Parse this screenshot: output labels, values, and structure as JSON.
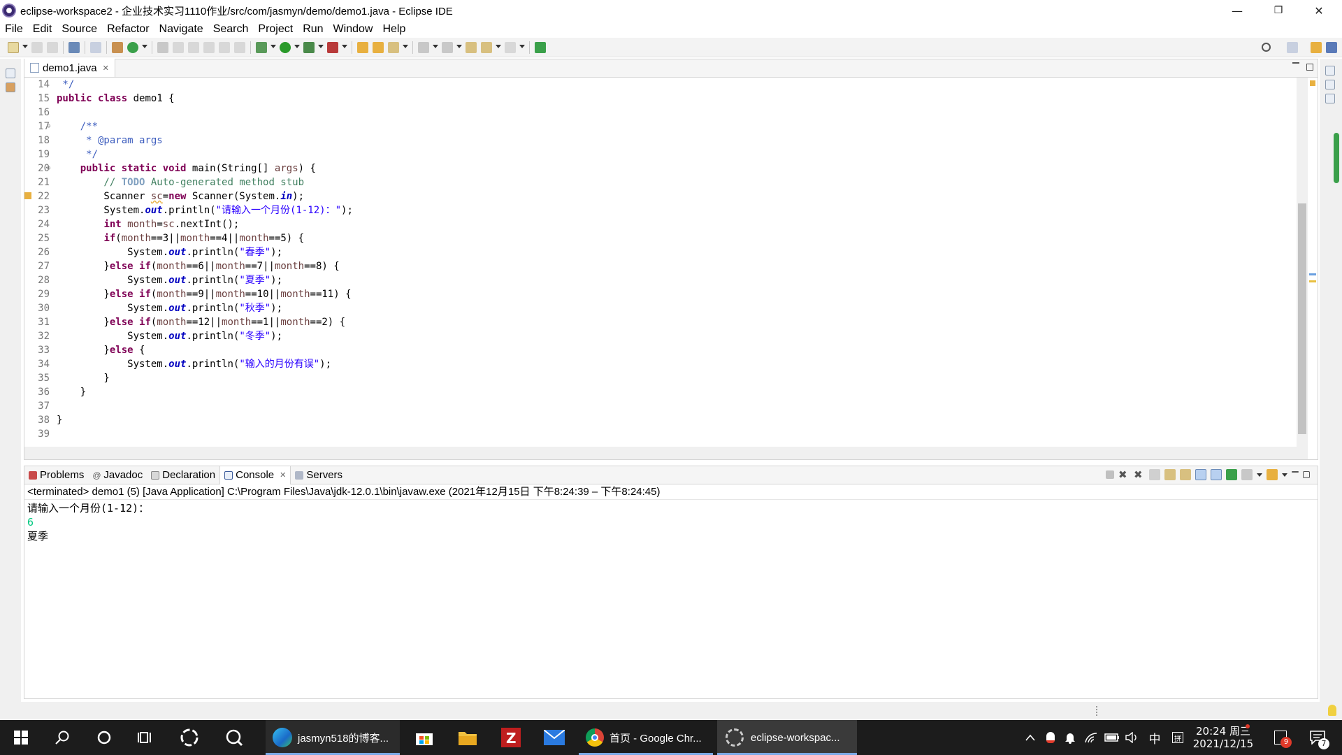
{
  "window": {
    "title": "eclipse-workspace2 - 企业技术实习1110作业/src/com/jasmyn/demo/demo1.java - Eclipse IDE",
    "minimize": "—",
    "restore": "❐",
    "close": "✕"
  },
  "menu": [
    "File",
    "Edit",
    "Source",
    "Refactor",
    "Navigate",
    "Search",
    "Project",
    "Run",
    "Window",
    "Help"
  ],
  "editor": {
    "tab_label": "demo1.java",
    "tab_close": "✕",
    "lines": [
      {
        "n": "14",
        "t": " */"
      },
      {
        "n": "15",
        "t": "public class demo1 {"
      },
      {
        "n": "16",
        "t": ""
      },
      {
        "n": "17",
        "t": "    /**"
      },
      {
        "n": "18",
        "t": "     * @param args"
      },
      {
        "n": "19",
        "t": "     */"
      },
      {
        "n": "20",
        "t": "    public static void main(String[] args) {"
      },
      {
        "n": "21",
        "t": "        // TODO Auto-generated method stub"
      },
      {
        "n": "22",
        "t": "        Scanner sc=new Scanner(System.in);"
      },
      {
        "n": "23",
        "t": "        System.out.println(\"请输入一个月份(1-12)：\");"
      },
      {
        "n": "24",
        "t": "        int month=sc.nextInt();"
      },
      {
        "n": "25",
        "t": "        if(month==3||month==4||month==5) {"
      },
      {
        "n": "26",
        "t": "            System.out.println(\"春季\");"
      },
      {
        "n": "27",
        "t": "        }else if(month==6||month==7||month==8) {"
      },
      {
        "n": "28",
        "t": "            System.out.println(\"夏季\");"
      },
      {
        "n": "29",
        "t": "        }else if(month==9||month==10||month==11) {"
      },
      {
        "n": "30",
        "t": "            System.out.println(\"秋季\");"
      },
      {
        "n": "31",
        "t": "        }else if(month==12||month==1||month==2) {"
      },
      {
        "n": "32",
        "t": "            System.out.println(\"冬季\");"
      },
      {
        "n": "33",
        "t": "        }else {"
      },
      {
        "n": "34",
        "t": "            System.out.println(\"输入的月份有误\");"
      },
      {
        "n": "35",
        "t": "        }"
      },
      {
        "n": "36",
        "t": "    }"
      },
      {
        "n": "37",
        "t": ""
      },
      {
        "n": "38",
        "t": "}"
      },
      {
        "n": "39",
        "t": ""
      }
    ]
  },
  "views": {
    "tabs": [
      "Problems",
      "Javadoc",
      "Declaration",
      "Console",
      "Servers"
    ],
    "active": "Console",
    "console_status": "<terminated> demo1 (5) [Java Application] C:\\Program Files\\Java\\jdk-12.0.1\\bin\\javaw.exe  (2021年12月15日 下午8:24:39 – 下午8:24:45)",
    "output": [
      "请输入一个月份(1-12)：",
      "6",
      "夏季"
    ]
  },
  "taskbar": {
    "edge_label": "jasmyn518的博客...",
    "chrome_label": "首页 - Google Chr...",
    "eclipse_label": "eclipse-workspac...",
    "time": "20:24 周三",
    "date": "2021/12/15",
    "ime": "中",
    "ime2": "拼",
    "notif_badge": "9",
    "action_badge": "7"
  },
  "colors": {
    "keyword": "#7f0055",
    "comment": "#3f7f5f",
    "javadoc": "#3f5fbf",
    "string": "#2a00ff",
    "field": "#0000c0",
    "console_input": "#00c87f"
  }
}
